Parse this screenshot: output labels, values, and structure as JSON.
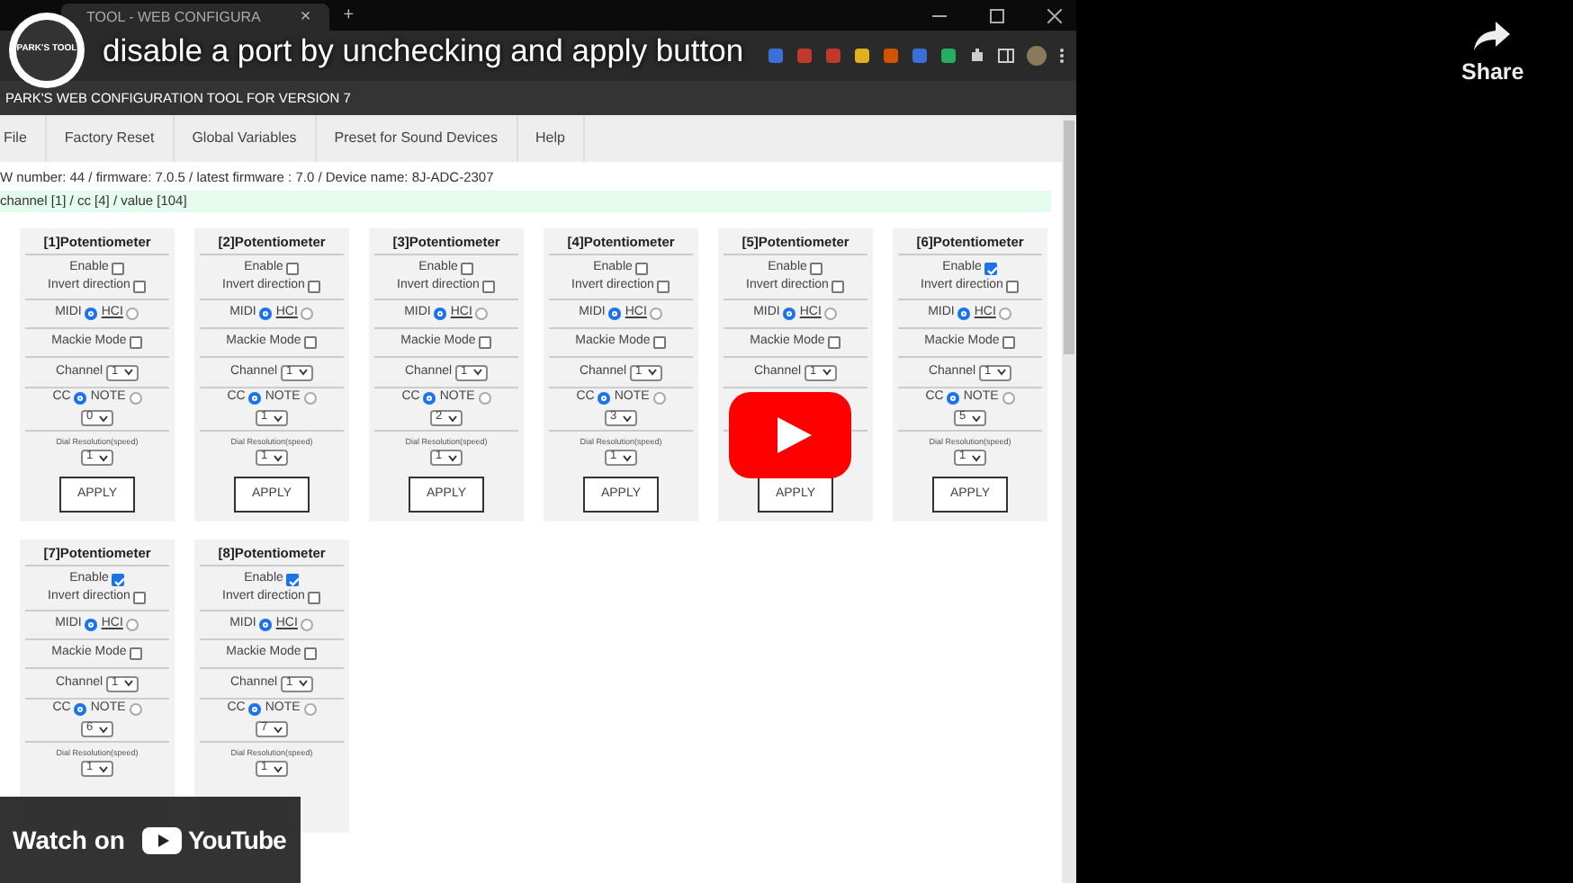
{
  "video": {
    "channel_logo_text": "PARK'S TOOL",
    "title": "disable a port by unchecking and apply button",
    "share": "Share",
    "watch_on": "Watch on",
    "youtube": "YouTube"
  },
  "browser": {
    "tab_title": "TOOL - WEB CONFIGURA",
    "tab_close": "×",
    "new_tab": "+"
  },
  "app": {
    "header": "PARK'S WEB CONFIGURATION TOOL FOR VERSION 7",
    "menu": [
      "File",
      "Factory Reset",
      "Global Variables",
      "Preset for Sound Devices",
      "Help"
    ],
    "info": "W number: 44 / firmware: 7.0.5 / latest firmware : 7.0 / Device name: 8J-ADC-2307",
    "status": "channel [1] / cc [4] / value [104]",
    "cards": [
      {
        "title": "[1]Potentiometer",
        "enable_label": "Enable",
        "enable": false,
        "invert_label": "Invert direction",
        "invert": false,
        "mode_options": [
          {
            "label": "MIDI",
            "selected": true
          },
          {
            "label": "HCI",
            "selected": false
          }
        ],
        "mackie_label": "Mackie Mode",
        "mackie": false,
        "channel_label": "Channel",
        "channel": "1",
        "type_options": [
          {
            "label": "CC",
            "selected": true
          },
          {
            "label": "NOTE",
            "selected": false
          }
        ],
        "cc_value": "0",
        "dial_label": "Dial Resolution(speed)",
        "dial": "1",
        "apply": "APPLY"
      },
      {
        "title": "[2]Potentiometer",
        "enable_label": "Enable",
        "enable": false,
        "invert_label": "Invert direction",
        "invert": false,
        "mode_options": [
          {
            "label": "MIDI",
            "selected": true
          },
          {
            "label": "HCI",
            "selected": false
          }
        ],
        "mackie_label": "Mackie Mode",
        "mackie": false,
        "channel_label": "Channel",
        "channel": "1",
        "type_options": [
          {
            "label": "CC",
            "selected": true
          },
          {
            "label": "NOTE",
            "selected": false
          }
        ],
        "cc_value": "1",
        "dial_label": "Dial Resolution(speed)",
        "dial": "1",
        "apply": "APPLY"
      },
      {
        "title": "[3]Potentiometer",
        "enable_label": "Enable",
        "enable": false,
        "invert_label": "Invert direction",
        "invert": false,
        "mode_options": [
          {
            "label": "MIDI",
            "selected": true
          },
          {
            "label": "HCI",
            "selected": false
          }
        ],
        "mackie_label": "Mackie Mode",
        "mackie": false,
        "channel_label": "Channel",
        "channel": "1",
        "type_options": [
          {
            "label": "CC",
            "selected": true
          },
          {
            "label": "NOTE",
            "selected": false
          }
        ],
        "cc_value": "2",
        "dial_label": "Dial Resolution(speed)",
        "dial": "1",
        "apply": "APPLY"
      },
      {
        "title": "[4]Potentiometer",
        "enable_label": "Enable",
        "enable": false,
        "invert_label": "Invert direction",
        "invert": false,
        "mode_options": [
          {
            "label": "MIDI",
            "selected": true
          },
          {
            "label": "HCI",
            "selected": false
          }
        ],
        "mackie_label": "Mackie Mode",
        "mackie": false,
        "channel_label": "Channel",
        "channel": "1",
        "type_options": [
          {
            "label": "CC",
            "selected": true
          },
          {
            "label": "NOTE",
            "selected": false
          }
        ],
        "cc_value": "3",
        "dial_label": "Dial Resolution(speed)",
        "dial": "1",
        "apply": "APPLY"
      },
      {
        "title": "[5]Potentiometer",
        "enable_label": "Enable",
        "enable": false,
        "invert_label": "Invert direction",
        "invert": false,
        "mode_options": [
          {
            "label": "MIDI",
            "selected": true
          },
          {
            "label": "HCI",
            "selected": false
          }
        ],
        "mackie_label": "Mackie Mode",
        "mackie": false,
        "channel_label": "Channel",
        "channel": "1",
        "apply": "APPLY"
      },
      {
        "title": "[6]Potentiometer",
        "enable_label": "Enable",
        "enable": true,
        "invert_label": "Invert direction",
        "invert": false,
        "mode_options": [
          {
            "label": "MIDI",
            "selected": true
          },
          {
            "label": "HCI",
            "selected": false
          }
        ],
        "mackie_label": "Mackie Mode",
        "mackie": false,
        "channel_label": "Channel",
        "channel": "1",
        "type_options": [
          {
            "label": "CC",
            "selected": true
          },
          {
            "label": "NOTE",
            "selected": false
          }
        ],
        "cc_value": "5",
        "dial_label": "Dial Resolution(speed)",
        "dial": "1",
        "apply": "APPLY"
      },
      {
        "title": "[7]Potentiometer",
        "enable_label": "Enable",
        "enable": true,
        "invert_label": "Invert direction",
        "invert": false,
        "mode_options": [
          {
            "label": "MIDI",
            "selected": true
          },
          {
            "label": "HCI",
            "selected": false
          }
        ],
        "mackie_label": "Mackie Mode",
        "mackie": false,
        "channel_label": "Channel",
        "channel": "1",
        "type_options": [
          {
            "label": "CC",
            "selected": true
          },
          {
            "label": "NOTE",
            "selected": false
          }
        ],
        "cc_value": "6",
        "dial_label": "Dial Resolution(speed)",
        "dial": "1"
      },
      {
        "title": "[8]Potentiometer",
        "enable_label": "Enable",
        "enable": true,
        "invert_label": "Invert direction",
        "invert": false,
        "mode_options": [
          {
            "label": "MIDI",
            "selected": true
          },
          {
            "label": "HCI",
            "selected": false
          }
        ],
        "mackie_label": "Mackie Mode",
        "mackie": false,
        "channel_label": "Channel",
        "channel": "1",
        "type_options": [
          {
            "label": "CC",
            "selected": true
          },
          {
            "label": "NOTE",
            "selected": false
          }
        ],
        "cc_value": "7",
        "dial_label": "Dial Resolution(speed)",
        "dial": "1"
      }
    ]
  }
}
